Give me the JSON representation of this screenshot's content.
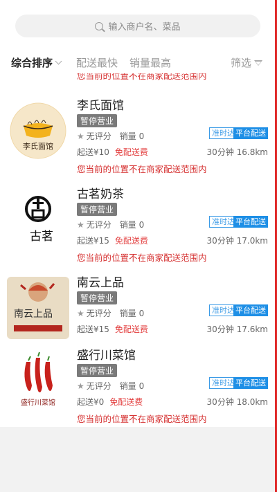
{
  "search": {
    "placeholder": "输入商户名、菜品"
  },
  "sort": {
    "items": [
      "综合排序",
      "配送最快",
      "销量最高"
    ],
    "filter": "筛选"
  },
  "partial_notice": "您当前的位置不在商家配送范围内",
  "restaurants": [
    {
      "name": "李氏面馆",
      "status": "暂停营业",
      "rating": "无评分",
      "sales": "销量 0",
      "tags": [
        "准时达",
        "平台配送"
      ],
      "min_order": "起送¥10",
      "delivery_fee": "免配送费",
      "time_distance": "30分钟 16.8km",
      "notice": "您当前的位置不在商家配送范围内",
      "logo_text": "李氏面馆"
    },
    {
      "name": "古茗奶茶",
      "status": "暂停营业",
      "rating": "无评分",
      "sales": "销量 0",
      "tags": [
        "准时达",
        "平台配送"
      ],
      "min_order": "起送¥15",
      "delivery_fee": "免配送费",
      "time_distance": "30分钟 17.0km",
      "notice": "您当前的位置不在商家配送范围内",
      "logo_text": "古茗"
    },
    {
      "name": "南云上品",
      "status": "暂停营业",
      "rating": "无评分",
      "sales": "销量 0",
      "tags": [
        "准时达",
        "平台配送"
      ],
      "min_order": "起送¥15",
      "delivery_fee": "免配送费",
      "time_distance": "30分钟 17.6km",
      "notice": "",
      "logo_text": "南云上品"
    },
    {
      "name": "盛行川菜馆",
      "status": "暂停营业",
      "rating": "无评分",
      "sales": "销量 0",
      "tags": [
        "准时达",
        "平台配送"
      ],
      "min_order": "起送¥0",
      "delivery_fee": "免配送费",
      "time_distance": "30分钟 18.0km",
      "notice": "您当前的位置不在商家配送范围内",
      "logo_text": "盛行川菜馆"
    }
  ],
  "colors": {
    "accent_red": "#d63333",
    "platform_blue": "#1e8fe6",
    "badge_gray": "#7a7a7a"
  }
}
